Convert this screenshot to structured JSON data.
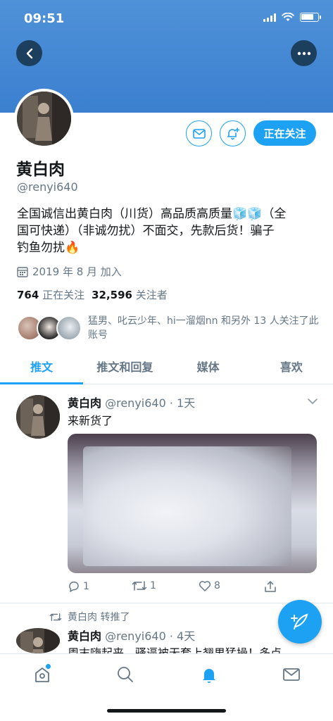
{
  "status_bar": {
    "time": "09:51"
  },
  "profile": {
    "display_name": "黄白肉",
    "handle": "@renyi640",
    "follow_label": "正在关注",
    "bio_line1": "全国诚信出黄白肉（川货）高品质高质量",
    "bio_line1_tail": "（全",
    "bio_line2": "国可快递）（非诚勿扰）不面交，先款后货！骗子",
    "bio_line3": "钓鱼勿扰",
    "joined": "2019 年 8 月 加入",
    "following_count": "764",
    "following_label": "正在关注",
    "followers_count": "32,596",
    "followers_label": "关注者",
    "followed_by_text": "猛男、叱云少年、hi一溜烟nn 和另外 13 人关注了此账号"
  },
  "tabs": [
    {
      "label": "推文",
      "active": true
    },
    {
      "label": "推文和回复",
      "active": false
    },
    {
      "label": "媒体",
      "active": false
    },
    {
      "label": "喜欢",
      "active": false
    }
  ],
  "tweets": [
    {
      "name": "黄白肉",
      "handle": "@renyi640",
      "time": "· 1天",
      "text": "来新货了",
      "reply_count": "1",
      "retweet_count": "1",
      "like_count": "8"
    },
    {
      "retweeted_by": "黄白肉 转推了",
      "name": "黄白肉",
      "handle": "@renyi640",
      "time": "· 4天",
      "text": "周末嗨起来，骚逼被无套上翘男猛操！多点"
    }
  ],
  "colors": {
    "accent": "#1da1f2",
    "banner": "#3b7fd0",
    "muted": "#657786"
  },
  "icons": [
    "back-icon",
    "more-icon",
    "mail-icon",
    "bell-plus-icon",
    "calendar-icon",
    "caret-down-icon",
    "reply-icon",
    "retweet-icon",
    "like-icon",
    "share-icon",
    "compose-icon",
    "home-icon",
    "search-icon",
    "bell-icon",
    "messages-icon"
  ]
}
